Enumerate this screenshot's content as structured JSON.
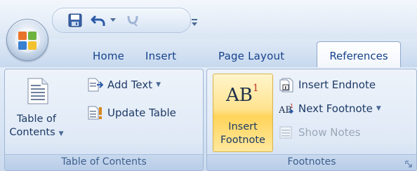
{
  "tabs": [
    {
      "label": "Home"
    },
    {
      "label": "Insert"
    },
    {
      "label": "Page Layout"
    },
    {
      "label": "References"
    }
  ],
  "toc_group": {
    "label": "Table of Contents",
    "table_of_contents_line1": "Table of",
    "table_of_contents_line2": "Contents",
    "add_text": "Add Text",
    "update_table": "Update Table"
  },
  "footnotes_group": {
    "label": "Footnotes",
    "ab_text": "AB",
    "ab_super": "1",
    "insert_footnote_line1": "Insert",
    "insert_footnote_line2": "Footnote",
    "insert_endnote": "Insert Endnote",
    "next_footnote": "Next Footnote",
    "show_notes": "Show Notes"
  },
  "colors": {
    "accent_text": "#15428b",
    "highlight": "#ffd45a"
  }
}
